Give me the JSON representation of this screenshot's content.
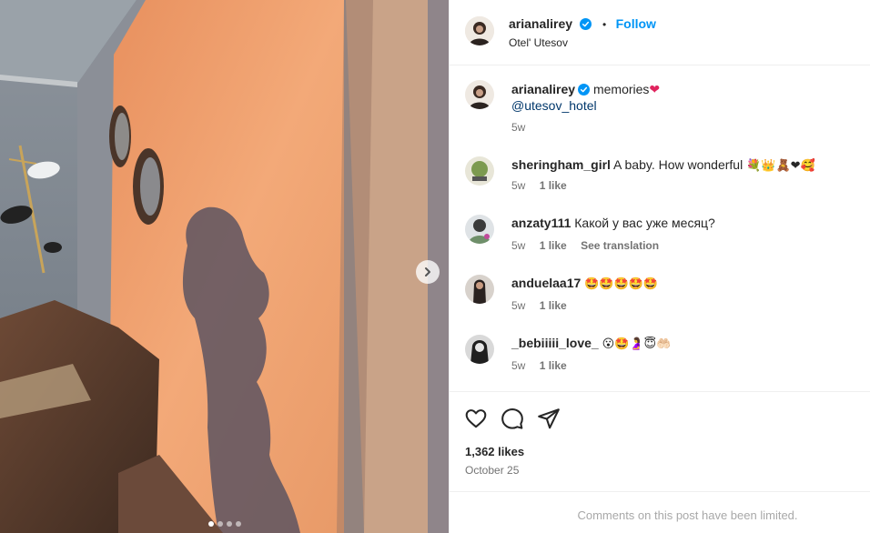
{
  "post": {
    "author": "arianalirey",
    "follow_label": "Follow",
    "bullet": "•",
    "location": "Otel' Utesov"
  },
  "caption": {
    "author": "arianalirey",
    "text": "memories",
    "heart": "❤",
    "mention": "@utesov_hotel",
    "time": "5w"
  },
  "comments": [
    {
      "author": "sheringham_girl",
      "text": "A baby. How wonderful",
      "emojis": "💐👑🧸❤🥰",
      "time": "5w",
      "likes": "1 like",
      "extra": ""
    },
    {
      "author": "anzaty111",
      "text": "Какой у вас уже месяц?",
      "emojis": "",
      "time": "5w",
      "likes": "1 like",
      "extra": "See translation"
    },
    {
      "author": "anduelaa17",
      "text": "",
      "emojis": "🤩🤩🤩🤩🤩",
      "time": "5w",
      "likes": "1 like",
      "extra": ""
    },
    {
      "author": "_bebiiiii_love_",
      "text": "",
      "emojis": "😮🤩🤰😇🤲🏻",
      "time": "5w",
      "likes": "1 like",
      "extra": ""
    }
  ],
  "stats": {
    "likes": "1,362 likes",
    "date": "October 25"
  },
  "footer": {
    "limited_text": "Comments on this post have been limited."
  },
  "carousel": {
    "total": 4,
    "active_index": 0
  },
  "colors": {
    "accent": "#0095f6",
    "verified": "#0095f6",
    "muted": "#737373",
    "wall_orange": "#f0a070"
  }
}
